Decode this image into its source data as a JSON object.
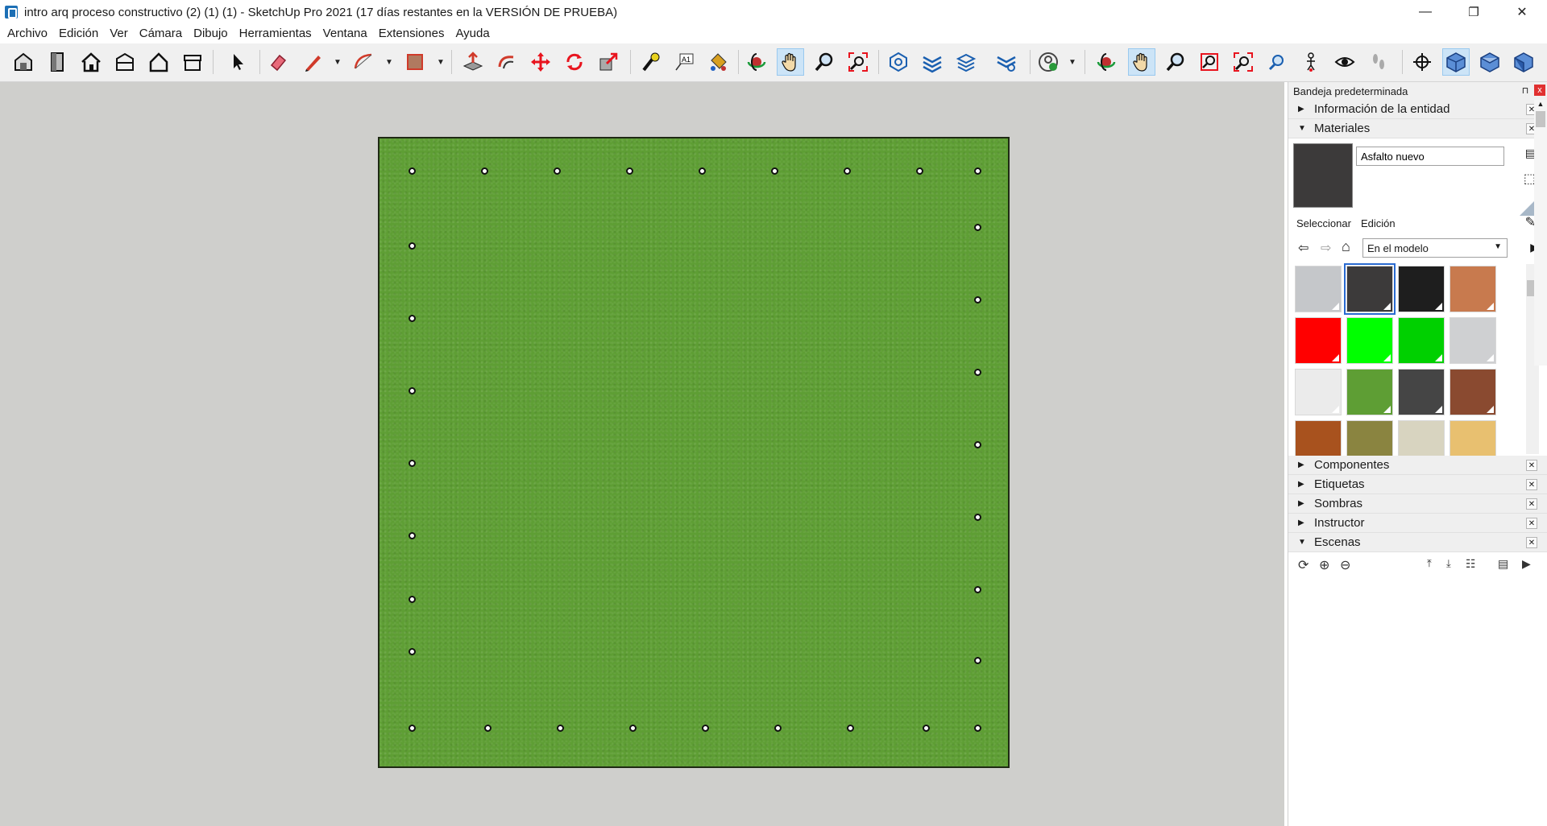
{
  "window": {
    "title": "intro arq proceso constructivo (2) (1) (1) - SketchUp Pro 2021 (17 días restantes en la VERSIÓN DE PRUEBA)",
    "minimize": "—",
    "restore": "❐",
    "close": "✕"
  },
  "menu": [
    "Archivo",
    "Edición",
    "Ver",
    "Cámara",
    "Dibujo",
    "Herramientas",
    "Ventana",
    "Extensiones",
    "Ayuda"
  ],
  "toolbar": {
    "active_tools": [
      "pan",
      "pan-2",
      "iso-view"
    ],
    "icons": [
      "warehouse-icon",
      "door-icon",
      "house-icon",
      "building-icon",
      "house-outline-icon",
      "shed-icon",
      "select-arrow-icon",
      "eraser-icon",
      "pencil-icon",
      "arc-icon",
      "rectangle-icon",
      "push-pull-icon",
      "follow-me-icon",
      "move-icon",
      "rotate-icon",
      "scale-icon",
      "tape-measure-icon",
      "text-icon",
      "paint-bucket-icon",
      "orbit-icon",
      "pan-icon",
      "zoom-icon",
      "zoom-extents-icon",
      "solid-tools-icon",
      "section-icon",
      "layers-icon",
      "styles-icon",
      "profile-icon"
    ]
  },
  "tray": {
    "title": "Bandeja predeterminada",
    "pin": "⊓",
    "close": "x",
    "sections_top": [
      {
        "label": "Información de la entidad",
        "expanded": false
      },
      {
        "label": "Materiales",
        "expanded": true
      }
    ],
    "materials": {
      "name_value": "Asfalto nuevo",
      "tabs": [
        "Seleccionar",
        "Edición"
      ],
      "collection": "En el modelo",
      "swatches": [
        "#c5c7ca",
        "#3c3a3a",
        "#1e1e1e",
        "#c87a4e",
        "#ff0000",
        "#00ff00",
        "#00d000",
        "#cfd0d2",
        "#ebebeb",
        "#5e9e34",
        "#454545",
        "#8a4a30",
        "#a8521e",
        "#8a8440",
        "#d8d4c0",
        "#e8c070"
      ],
      "selected_index": 1
    },
    "sections_bottom": [
      {
        "label": "Componentes",
        "expanded": false
      },
      {
        "label": "Etiquetas",
        "expanded": false
      },
      {
        "label": "Sombras",
        "expanded": false
      },
      {
        "label": "Instructor",
        "expanded": false
      },
      {
        "label": "Escenas",
        "expanded": true
      }
    ]
  },
  "colors": {
    "grass": "#5e9e34",
    "viewport_bg": "#cfcfcc",
    "selection": "#2a6ad0"
  }
}
